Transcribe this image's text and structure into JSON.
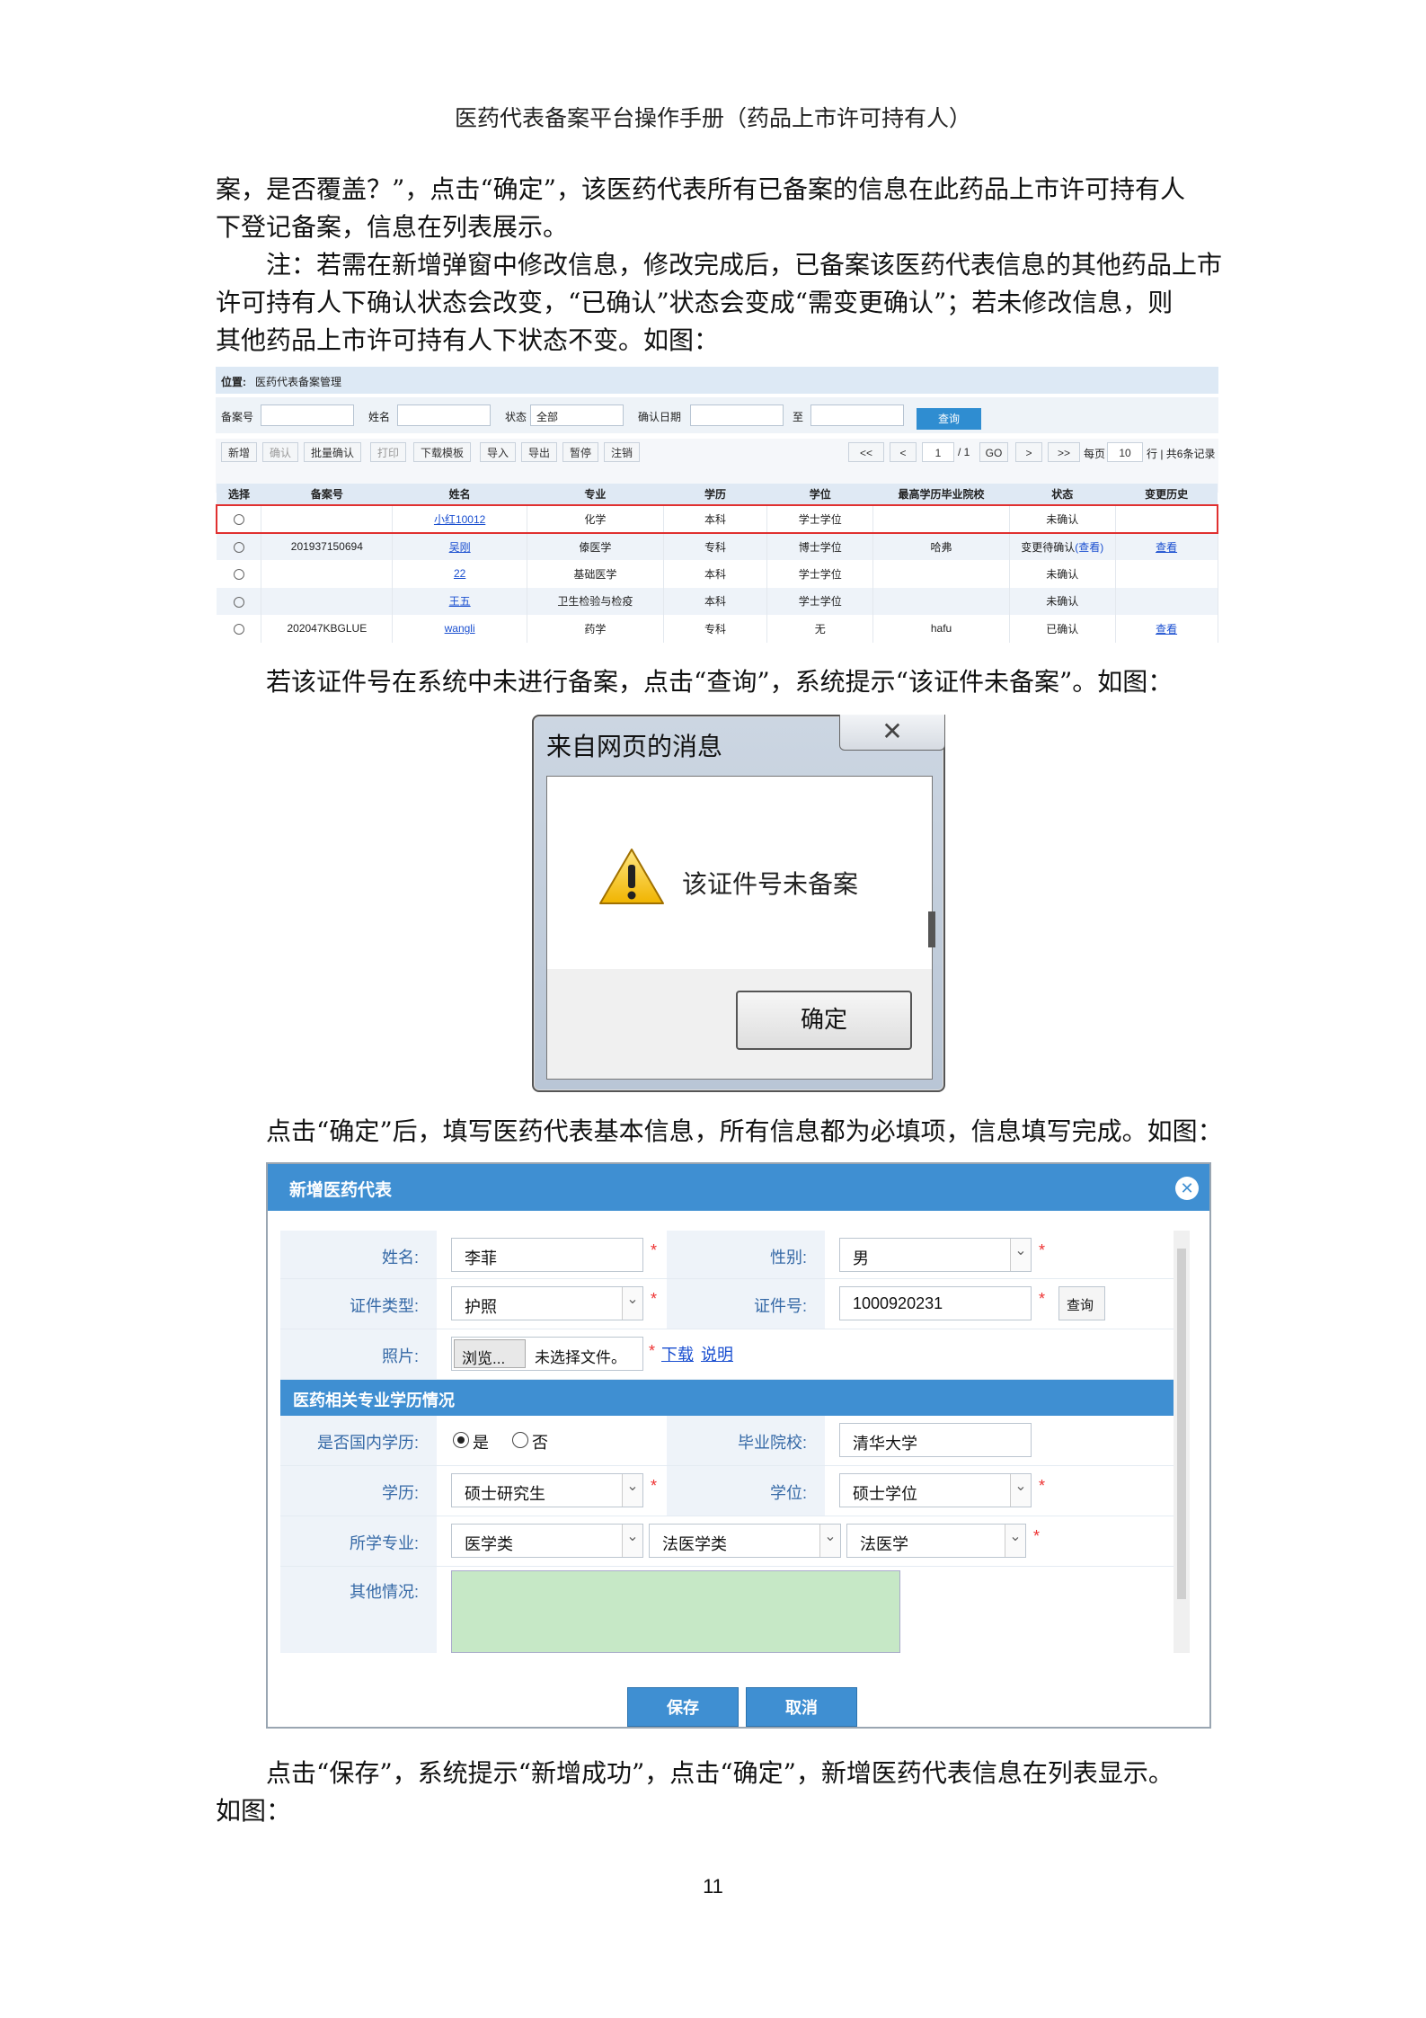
{
  "header": {
    "title": "医药代表备案平台操作手册（药品上市许可持有人）"
  },
  "paragraphs": {
    "p1_l1": "案，是否覆盖？”，点击“确定”，该医药代表所有已备案的信息在此药品上市许可持有人",
    "p1_l2": "下登记备案，信息在列表展示。",
    "p2_l1": "注：若需在新增弹窗中修改信息，修改完成后，已备案该医药代表信息的其他药品上市",
    "p2_l2": "许可持有人下确认状态会改变，“已确认”状态会变成“需变更确认”；若未修改信息，则",
    "p2_l3": "其他药品上市许可持有人下状态不变。如图：",
    "p3_l1": "若该证件号在系统中未进行备案，点击“查询”，系统提示“该证件未备案”。如图：",
    "p4_l1": "点击“确定”后，填写医药代表基本信息，所有信息都为必填项，信息填写完成。如图：",
    "p5_l1": "点击“保存”，系统提示“新增成功”，点击“确定”，新增医药代表信息在列表显示。",
    "p5_l2": "如图："
  },
  "screenshot1": {
    "location_label": "位置:",
    "location_value": "医药代表备案管理",
    "search": {
      "record_no_label": "备案号",
      "name_label": "姓名",
      "status_label": "状态",
      "status_value": "全部",
      "confirm_date_label": "确认日期",
      "to_label": "至",
      "query_button": "查询"
    },
    "toolbar": [
      "新增",
      "确认",
      "批量确认",
      "打印",
      "下载模板",
      "导入",
      "导出",
      "暂停",
      "注销"
    ],
    "pager": {
      "first": "<<",
      "prev": "<",
      "page": "1",
      "total": "/ 1",
      "go": "GO",
      "next": ">",
      "last": ">>",
      "per_page_label": "每页",
      "per_page": "10",
      "summary": "行 | 共6条记录"
    },
    "columns": [
      "选择",
      "备案号",
      "姓名",
      "专业",
      "学历",
      "学位",
      "最高学历毕业院校",
      "状态",
      "变更历史"
    ],
    "rows": [
      {
        "record_no": "",
        "name": "小红10012",
        "major": "化学",
        "edu": "本科",
        "degree": "学士学位",
        "school": "",
        "status": "未确认",
        "history": ""
      },
      {
        "record_no": "201937150694",
        "name": "吴刚",
        "major": "傣医学",
        "edu": "专科",
        "degree": "博士学位",
        "school": "哈弗",
        "status": "变更待确认",
        "status_link": "(查看)",
        "history": "查看"
      },
      {
        "record_no": "",
        "name": "22",
        "major": "基础医学",
        "edu": "本科",
        "degree": "学士学位",
        "school": "",
        "status": "未确认",
        "history": ""
      },
      {
        "record_no": "",
        "name": "王五",
        "major": "卫生检验与检疫",
        "edu": "本科",
        "degree": "学士学位",
        "school": "",
        "status": "未确认",
        "history": ""
      },
      {
        "record_no": "202047KBGLUE",
        "name": "wangli",
        "major": "药学",
        "edu": "专科",
        "degree": "无",
        "school": "hafu",
        "status": "已确认",
        "history": "查看"
      }
    ]
  },
  "dialog": {
    "title": "来自网页的消息",
    "close": "✕",
    "message": "该证件号未备案",
    "ok": "确定"
  },
  "form": {
    "title": "新增医药代表",
    "close": "✕",
    "name_label": "姓名:",
    "name_value": "李菲",
    "gender_label": "性别:",
    "gender_value": "男",
    "id_type_label": "证件类型:",
    "id_type_value": "护照",
    "id_no_label": "证件号:",
    "id_no_value": "1000920231",
    "id_query": "查询",
    "photo_label": "照片:",
    "browse": "浏览...",
    "no_file": "未选择文件。",
    "download": "下载",
    "explain": "说明",
    "section": "医药相关专业学历情况",
    "domestic_label": "是否国内学历:",
    "yes": "是",
    "no": "否",
    "school_label": "毕业院校:",
    "school_value": "清华大学",
    "edu_label": "学历:",
    "edu_value": "硕士研究生",
    "degree_label": "学位:",
    "degree_value": "硕士学位",
    "major_label": "所学专业:",
    "major1": "医学类",
    "major2": "法医学类",
    "major3": "法医学",
    "other_label": "其他情况:",
    "save": "保存",
    "cancel": "取消"
  },
  "page_number": "11"
}
